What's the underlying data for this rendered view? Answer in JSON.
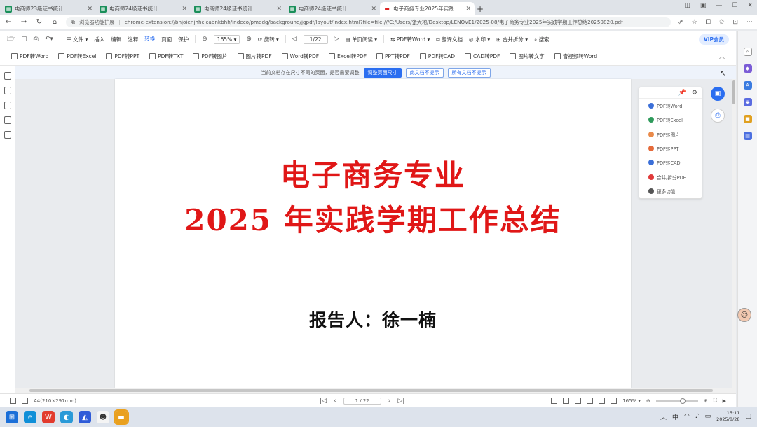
{
  "browser": {
    "tabs": [
      {
        "title": "电商师23级证书统计",
        "icon": "sheet",
        "active": false
      },
      {
        "title": "电商师24级证书统计",
        "icon": "sheet",
        "active": false
      },
      {
        "title": "电商师24级证书统计",
        "icon": "sheet",
        "active": false
      },
      {
        "title": "电商师24级证书统计",
        "icon": "sheet",
        "active": false
      },
      {
        "title": "电子商务专业2025年实践学期工...",
        "icon": "pdf",
        "active": true
      }
    ],
    "new_tab": "+",
    "address": {
      "label": "浏览器功能扩展",
      "url": "chrome-extension://bnjoienjhhclcabnkbhh/indeco/pmedg/background/jgpdf/layout/index.html?file=file:///C:/Users/张天地/Desktop/LENOVE1/2025-08/电子商务专业2025年实践学期工作总结20250820.pdf"
    }
  },
  "toolbar1": {
    "file": "文件",
    "insert": "插入",
    "edit": "编辑",
    "annotate": "注释",
    "convert": "转换",
    "page": "页面",
    "protect": "保护",
    "zoom": "165%",
    "rotate": "旋转",
    "page_indicator": "1/22",
    "view_mode": "单页阅读",
    "pdf_to_word": "PDF转Word",
    "translate": "翻译文档",
    "watermark": "水印",
    "merge_split": "合并拆分",
    "search": "搜索",
    "vip": "VIP会员"
  },
  "toolbar2": {
    "tools": [
      "PDF转Word",
      "PDF转Excel",
      "PDF转PPT",
      "PDF转TXT",
      "PDF转图片",
      "图片转PDF",
      "Word转PDF",
      "Excel转PDF",
      "PPT转PDF",
      "PDF转CAD",
      "CAD转PDF",
      "图片转文字",
      "音视频转Word"
    ]
  },
  "notice": {
    "text": "当前文档存在尺寸不同的页面，是否需要调整",
    "adjust": "调整页面尺寸",
    "skip_once": "此文档不提示",
    "skip_all": "所有文档不提示"
  },
  "document": {
    "title_line1": "电子商务专业",
    "title_line2": "2025 年实践学期工作总结",
    "reporter": "报告人：徐一楠",
    "title_color": "#e01717"
  },
  "float_panel": {
    "items": [
      {
        "label": "PDF转Word",
        "color": "#3b6fd8"
      },
      {
        "label": "PDF转Excel",
        "color": "#2e9a5b"
      },
      {
        "label": "PDF转图片",
        "color": "#e98a4a"
      },
      {
        "label": "PDF转PPT",
        "color": "#e56a3a"
      },
      {
        "label": "PDF转CAD",
        "color": "#3b6fd8"
      },
      {
        "label": "合并/拆分PDF",
        "color": "#e03a3a"
      },
      {
        "label": "更多功能",
        "color": "#555555"
      }
    ]
  },
  "status": {
    "page_size": "A4(210×297mm)",
    "page_indicator": "1 / 22",
    "zoom": "165%"
  },
  "taskbar": {
    "time": "15:11",
    "date": "2025/8/28"
  },
  "colors": {
    "accent": "#2b6ef0"
  }
}
